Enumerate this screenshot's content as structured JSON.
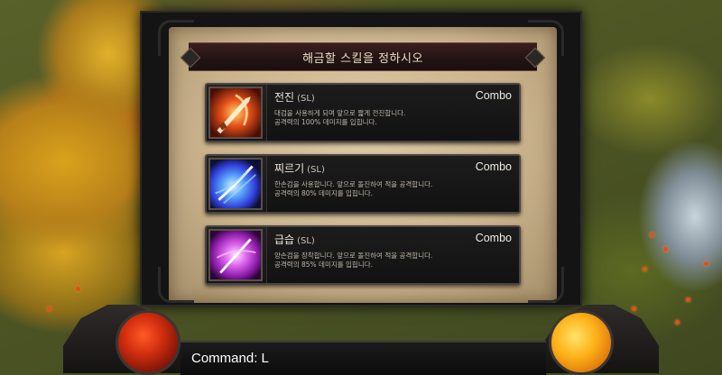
{
  "dialog": {
    "title": "해금할 스킬을 정하시오",
    "skills": [
      {
        "name": "전진",
        "tag": "(SL)",
        "type": "Combo",
        "desc_line1": "대검을 사용하게 되며 앞으로 짧게 전진합니다.",
        "desc_line2": "공격력의 100% 데미지를 입힙니다.",
        "icon": "greatsword-slash-icon",
        "icon_color": "#e8521a"
      },
      {
        "name": "찌르기",
        "tag": "(SL)",
        "type": "Combo",
        "desc_line1": "한손검을 사용합니다. 앞으로 돌진하여 적을 공격합니다.",
        "desc_line2": "공격력의 80% 데미지를 입힙니다.",
        "icon": "sword-thrust-icon",
        "icon_color": "#2f6bf0"
      },
      {
        "name": "급습",
        "tag": "(SL)",
        "type": "Combo",
        "desc_line1": "양손검을 장착합니다. 앞으로 돌진하여 적을 공격합니다.",
        "desc_line2": "공격력의 85% 데미지를 입힙니다.",
        "icon": "dual-blade-strike-icon",
        "icon_color": "#c23ad6"
      }
    ]
  },
  "hud": {
    "command_label": "Command:",
    "command_value": "L",
    "health_color": "#d6300f",
    "mana_color": "#ffb31a"
  }
}
